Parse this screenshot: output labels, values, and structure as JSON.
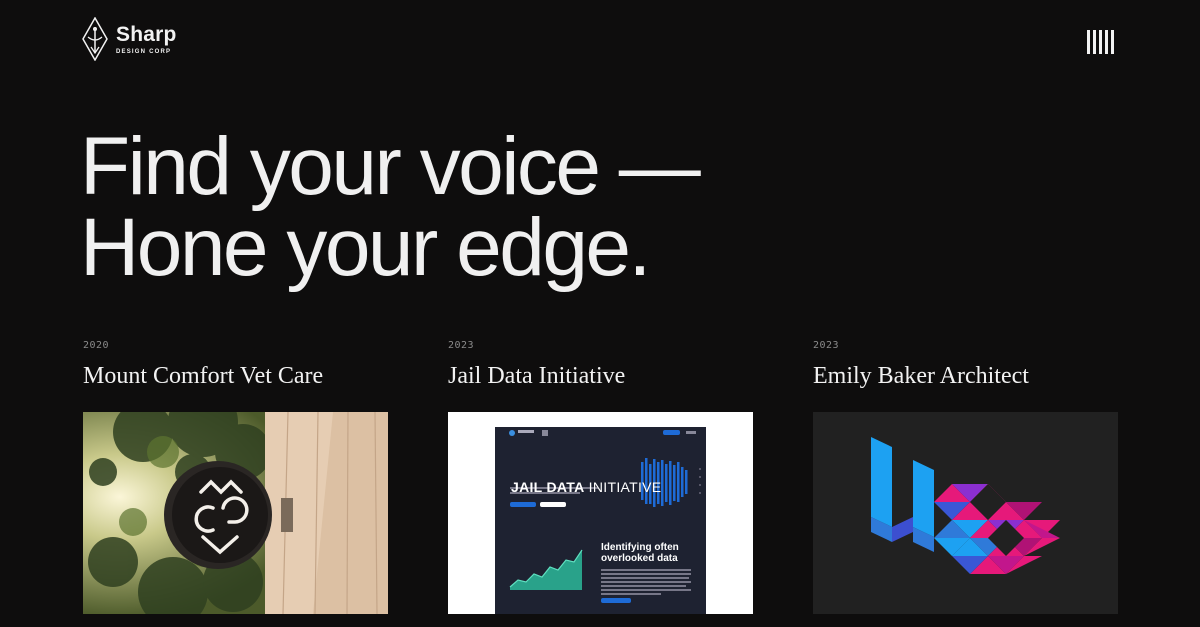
{
  "brand": {
    "name": "Sharp",
    "tagline": "DESIGN CORP"
  },
  "menu": {
    "icon": "menu-bars-icon"
  },
  "hero": {
    "line1": "Find your voice —",
    "line2": "Hone your edge."
  },
  "projects": [
    {
      "year": "2020",
      "title": "Mount Comfort Vet Care",
      "image": "vet-sign-photo"
    },
    {
      "year": "2023",
      "title": "Jail Data Initiative",
      "image": "website-mockup",
      "mockup": {
        "heading_bold": "JAIL DATA",
        "heading_light": " INITIATIVE",
        "subheading": "Identifying often overlooked data"
      }
    },
    {
      "year": "2023",
      "title": "Emily Baker Architect",
      "image": "geometric-logo"
    }
  ],
  "colors": {
    "background": "#0e0d0d",
    "text": "#f2f2f2",
    "accent_blue": "#1e6bd6",
    "accent_magenta": "#e6197a",
    "mockup_navy": "#1e2231"
  }
}
